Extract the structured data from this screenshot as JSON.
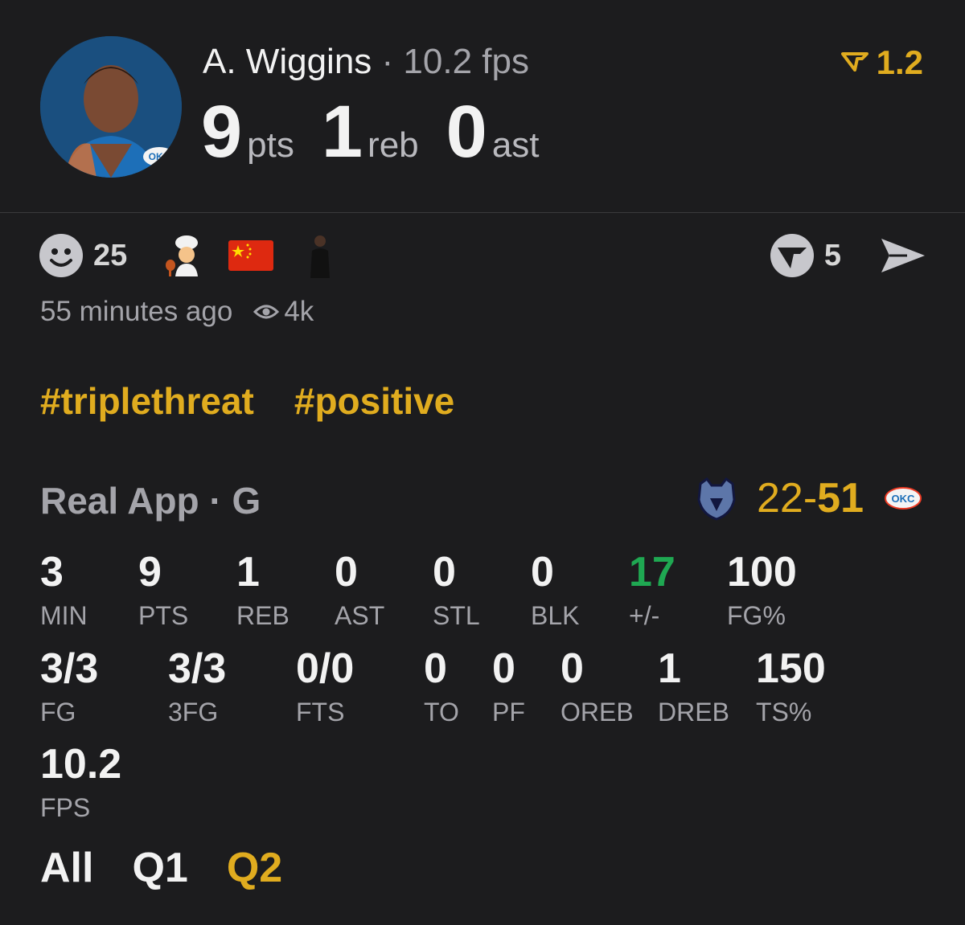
{
  "player": {
    "name": "A. Wiggins",
    "fps_label": "10.2 fps",
    "points": "9",
    "points_unit": "pts",
    "rebounds": "1",
    "rebounds_unit": "reb",
    "assists": "0",
    "assists_unit": "ast",
    "avatar_text": "OKC"
  },
  "rating": {
    "value": "1.2",
    "icon": "v-chevron-icon"
  },
  "reactions": {
    "count": "25",
    "emojis": [
      "smiley-icon",
      "chef-emoji",
      "china-flag-emoji",
      "person-figure-emoji"
    ],
    "badge_count": "5"
  },
  "meta": {
    "time_ago": "55 minutes ago",
    "views": "4k"
  },
  "tags": [
    "#triplethreat",
    "#positive"
  ],
  "source": {
    "label": "Real App · G"
  },
  "score": {
    "away": "22",
    "separator": "-",
    "home": "51",
    "home_logo_text": "OKC"
  },
  "stats_row1": [
    {
      "value": "3",
      "label": "MIN"
    },
    {
      "value": "9",
      "label": "PTS"
    },
    {
      "value": "1",
      "label": "REB"
    },
    {
      "value": "0",
      "label": "AST"
    },
    {
      "value": "0",
      "label": "STL"
    },
    {
      "value": "0",
      "label": "BLK"
    },
    {
      "value": "17",
      "label": "+/-"
    },
    {
      "value": "100",
      "label": "FG%"
    }
  ],
  "stats_row2": [
    {
      "value": "3/3",
      "label": "FG"
    },
    {
      "value": "3/3",
      "label": "3FG"
    },
    {
      "value": "0/0",
      "label": "FTS"
    },
    {
      "value": "0",
      "label": "TO"
    },
    {
      "value": "0",
      "label": "PF"
    },
    {
      "value": "0",
      "label": "OREB"
    },
    {
      "value": "1",
      "label": "DREB"
    },
    {
      "value": "150",
      "label": "TS%"
    }
  ],
  "stats_row3": [
    {
      "value": "10.2",
      "label": "FPS"
    }
  ],
  "quarters": [
    "All",
    "Q1",
    "Q2"
  ],
  "colors": {
    "accent": "#e0ac1f",
    "positive": "#1fa852",
    "background": "#1c1c1e"
  }
}
